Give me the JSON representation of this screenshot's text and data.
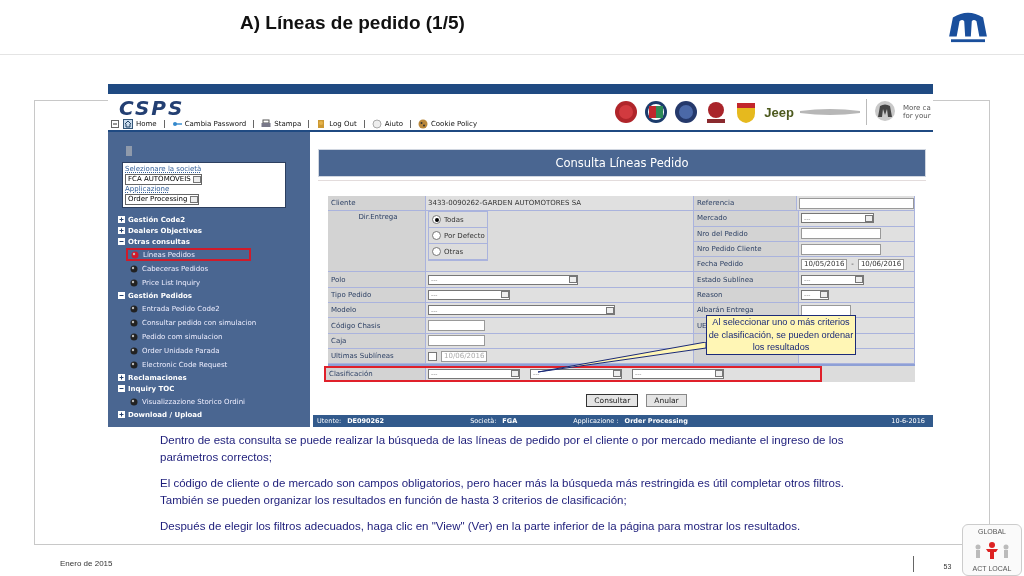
{
  "slide_title": "A) Líneas de pedido (1/5)",
  "app": {
    "logo": "CSPS",
    "nav": [
      {
        "kind": "collapse"
      },
      {
        "kind": "home",
        "label": "Home"
      },
      {
        "kind": "key",
        "label": "Cambia Password"
      },
      {
        "kind": "printer",
        "label": "Stampa"
      },
      {
        "kind": "logout",
        "label": "Log Out"
      },
      {
        "kind": "help",
        "label": "Aiuto"
      },
      {
        "kind": "cookie",
        "label": "Cookie Policy"
      }
    ],
    "brand_text": "Jeep",
    "tagline": [
      "More ca",
      "for your"
    ],
    "company_select": {
      "label": "Selezionare la società",
      "value": "FCA AUTOMOVEIS"
    },
    "application_select": {
      "label": "Applicazione",
      "value": "Order Processing"
    },
    "menu": [
      {
        "label": "Gestión Code2",
        "expanded": false
      },
      {
        "label": "Dealers Objectives",
        "expanded": false
      },
      {
        "label": "Otras consultas",
        "expanded": true,
        "children": [
          {
            "label": "Líneas Pedidos",
            "selected": true
          },
          {
            "label": "Cabeceras Pedidos",
            "selected": false
          },
          {
            "label": "Price List Inquiry",
            "selected": false
          }
        ]
      },
      {
        "label": "Gestión Pedidos",
        "expanded": true,
        "children": [
          {
            "label": "Entrada Pedido Code2",
            "selected": false
          },
          {
            "label": "Consultar pedido con simulacion",
            "selected": false
          },
          {
            "label": "Pedido com simulacion",
            "selected": false
          },
          {
            "label": "Order Unidade Parada",
            "selected": false
          },
          {
            "label": "Electronic Code Request",
            "selected": false
          }
        ]
      },
      {
        "label": "Reclamaciones",
        "expanded": false
      },
      {
        "label": "Inquiry TOC",
        "expanded": true,
        "children": [
          {
            "label": "Visualizzazione Storico Ordini",
            "selected": false
          }
        ]
      },
      {
        "label": "Download / Upload",
        "expanded": false
      }
    ],
    "form_title": "Consulta Líneas Pedido",
    "left_fields": [
      {
        "label": "Cliente",
        "kind": "text",
        "value": "3433-0090262-GARDEN AUTOMOTORES SA"
      },
      {
        "label": "Dir.Entrega",
        "kind": "radio",
        "options": [
          {
            "label": "Todas",
            "selected": true
          },
          {
            "label": "Por Defecto",
            "selected": false
          },
          {
            "label": "Otras",
            "selected": false
          }
        ]
      },
      {
        "label": "Polo",
        "kind": "select",
        "value": "---"
      },
      {
        "label": "Tipo Pedido",
        "kind": "select",
        "value": "---"
      },
      {
        "label": "Modelo",
        "kind": "select",
        "value": "---"
      },
      {
        "label": "Código Chasis",
        "kind": "input"
      },
      {
        "label": "Caja",
        "kind": "input"
      },
      {
        "label": "Ultimas Sublíneas",
        "kind": "check_date",
        "checked": false,
        "value": "10/06/2016",
        "disabled": true
      }
    ],
    "right_fields": [
      {
        "label": "Referencia",
        "kind": "input"
      },
      {
        "label": "Mercado",
        "kind": "select",
        "value": "---"
      },
      {
        "label": "Nro del Pedido",
        "kind": "input"
      },
      {
        "label": "Nro Pedido Cliente",
        "kind": "input"
      },
      {
        "label": "Fecha Pedido",
        "kind": "date_range",
        "values": [
          "10/05/2016",
          "10/06/2016"
        ],
        "separator": "-"
      },
      {
        "label": "Estado Sublínea",
        "kind": "select",
        "value": "---"
      },
      {
        "label": "Reason",
        "kind": "select",
        "value": "---"
      },
      {
        "label": "Albarán Entrega",
        "kind": "input"
      },
      {
        "label": "UE",
        "kind": "covered"
      }
    ],
    "sort_field": {
      "label": "Clasificación",
      "selects": [
        "---",
        "---",
        "---"
      ]
    },
    "buttons": [
      "Consultar",
      "Anular"
    ],
    "status_bar": {
      "user_label": "Utente:",
      "user": "DE090262",
      "company_label": "Società:",
      "company": "FGA",
      "app_label": "Applicazione :",
      "app": "Order Processing",
      "date": "10-6-2016"
    }
  },
  "callout": "Al seleccionar uno o más criterios de clasificación, se pueden ordenar los resultados",
  "paragraphs": [
    "Dentro de esta consulta se puede realizar la búsqueda de las líneas de pedido por el cliente o por mercado mediante el ingreso de los parámetros correctos;",
    "El código de cliente o de mercado son campos obligatorios, pero hacer más la búsqueda más restringida es útil completar otros filtros. También se pueden organizar los resultados en función de hasta 3 criterios de clasificación;",
    "Después de elegir los filtros adecuados, haga clic en \"View\" (Ver) en la parte inferior de la página para mostrar los resultados."
  ],
  "footer": {
    "date": "Enero de 2015",
    "page": "53"
  },
  "badge": {
    "top": "GLOBAL",
    "bottom": "ACT LOCAL"
  }
}
